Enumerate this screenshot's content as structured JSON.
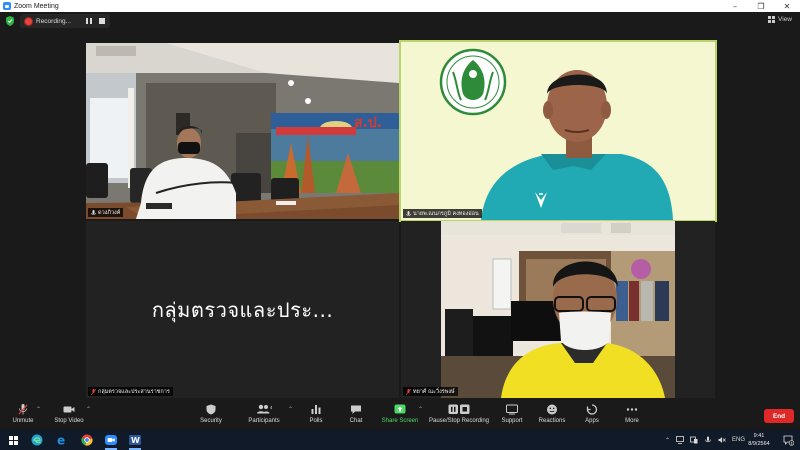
{
  "window": {
    "title": "Zoom Meeting"
  },
  "meeting_bar": {
    "recording_label": "Recording...",
    "view_label": "View"
  },
  "tiles": [
    {
      "name": "ดวงภิวงค์"
    },
    {
      "name": "นายพ.ณนภรภูมิ คงทองอ่อน"
    },
    {
      "name": "กลุ่มตรวจและประสานราชการ",
      "display_text": "กลุ่มตรวจและประ..."
    },
    {
      "name": "ทยาศ์ ณะวิ่งรพงษ์"
    }
  ],
  "toolbar": {
    "unmute": "Unmute",
    "stop_video": "Stop Video",
    "security": "Security",
    "participants": "Participants",
    "participant_count": "4",
    "polls": "Polls",
    "chat": "Chat",
    "share_screen": "Share Screen",
    "pause_stop_recording": "Pause/Stop Recording",
    "support": "Support",
    "reactions": "Reactions",
    "apps": "Apps",
    "more": "More",
    "end": "End"
  },
  "taskbar": {
    "language": "ENG",
    "time": "9:41",
    "date": "8/9/2564",
    "notification_count": "1"
  },
  "colors": {
    "share_green": "#4cd964",
    "end_red": "#e02828",
    "active_speaker": "#b8d46a",
    "recording_red": "#e8413c"
  }
}
